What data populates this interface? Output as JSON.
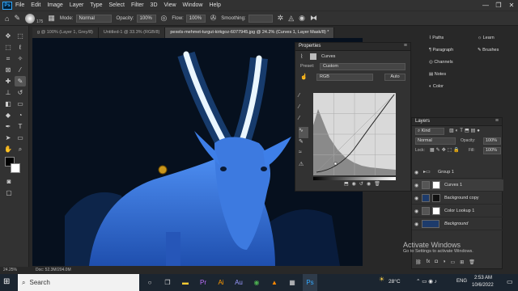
{
  "menu": {
    "logo": "Ps",
    "items": [
      "File",
      "Edit",
      "Image",
      "Layer",
      "Type",
      "Select",
      "Filter",
      "3D",
      "View",
      "Window",
      "Help"
    ]
  },
  "window_controls": [
    "—",
    "❐",
    "✕"
  ],
  "options_bar": {
    "brush_size": "175",
    "mode_label": "Mode:",
    "mode_value": "Normal",
    "opacity_label": "Opacity:",
    "opacity_value": "100%",
    "flow_label": "Flow:",
    "flow_value": "100%",
    "smoothing_label": "Smoothing:",
    "smoothing_value": ""
  },
  "tabs": [
    {
      "label": "g @ 100% (Layer 1, Grey/8)",
      "active": false
    },
    {
      "label": "Untitled-1 @ 33.3% (RGB/8)",
      "active": false
    },
    {
      "label": "pexels-mehmet-turgut-kirkgoz-6077945.jpg @ 24.2% (Curves 1, Layer Mask/8) *",
      "active": true
    }
  ],
  "properties": {
    "title": "Properties",
    "type_label": "Curves",
    "preset_label": "Preset:",
    "preset_value": "Custom",
    "channel_value": "RGB",
    "auto_label": "Auto"
  },
  "dock_panels": {
    "left_col": [
      "Paths",
      "Paragraph",
      "Channels",
      "Notes",
      "Color"
    ],
    "right_col": [
      "Learn",
      "Brushes"
    ]
  },
  "layers": {
    "title": "Layers",
    "kind_label": "Kind",
    "blend_value": "Normal",
    "opacity_label": "Opacity:",
    "opacity_value": "100%",
    "lock_label": "Lock:",
    "fill_label": "Fill:",
    "fill_value": "100%",
    "rows": [
      {
        "name": "Group 1",
        "type": "group",
        "selected": false
      },
      {
        "name": "Curves 1",
        "type": "adjust",
        "selected": true
      },
      {
        "name": "Background copy",
        "type": "image",
        "selected": false
      },
      {
        "name": "Color Lookup 1",
        "type": "adjust",
        "selected": false
      },
      {
        "name": "Background",
        "type": "image",
        "selected": false
      }
    ]
  },
  "status": {
    "zoom": "24.25%",
    "doc": "Doc: 52.3M/204.0M"
  },
  "watermark": {
    "title": "Activate Windows",
    "subtitle": "Go to Settings to activate Windows."
  },
  "taskbar": {
    "search_placeholder": "Search",
    "weather": "28°C",
    "language": "ENG",
    "time": "2:53 AM",
    "date": "10/6/2022"
  },
  "colors": {
    "accent": "#31a8ff",
    "canvas_bg": "#06101e",
    "image_blue": "#2f6fd8"
  }
}
